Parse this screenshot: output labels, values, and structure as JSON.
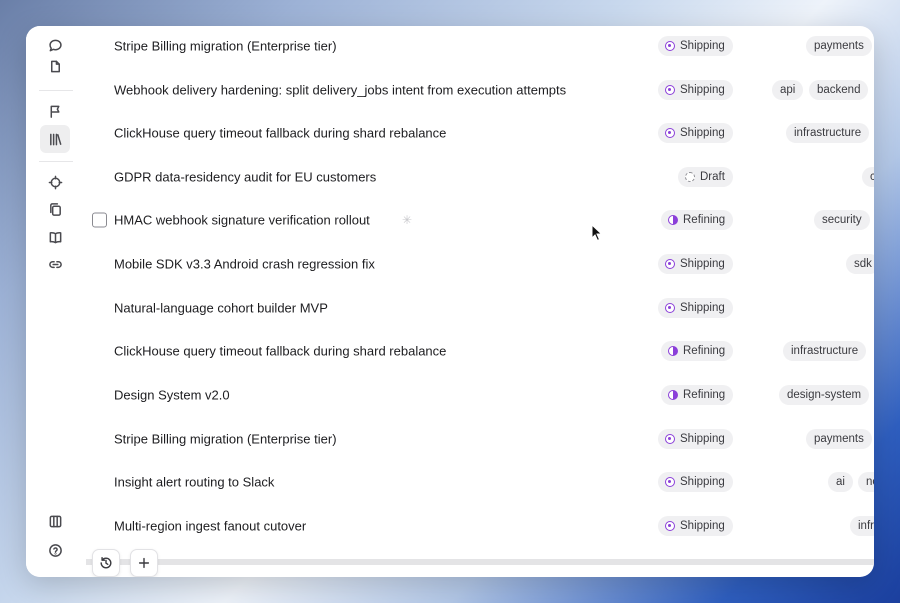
{
  "sidebar": {
    "top_icons": [
      "chat-icon",
      "document-icon"
    ],
    "mid_icons": [
      "flag-icon",
      "library-icon"
    ],
    "tool_icons": [
      "crosshair-icon",
      "copy-icon",
      "book-icon",
      "link-icon"
    ],
    "bottom_icons": [
      "columns-icon",
      "help-icon"
    ]
  },
  "rows": [
    {
      "title": "Stripe Billing migration (Enterprise tier)",
      "status": "Shipping",
      "tags": [
        "payments"
      ]
    },
    {
      "title": "Webhook delivery hardening: split delivery_jobs intent from execution attempts",
      "status": "Shipping",
      "tags": [
        "api",
        "backend"
      ]
    },
    {
      "title": "ClickHouse query timeout fallback during shard rebalance",
      "status": "Shipping",
      "tags": [
        "infrastructure"
      ]
    },
    {
      "title": "GDPR data-residency audit for EU customers",
      "status": "Draft",
      "tags": [
        "c"
      ]
    },
    {
      "title": "HMAC webhook signature verification rollout",
      "status": "Refining",
      "tags": [
        "security"
      ]
    },
    {
      "title": "Mobile SDK v3.3 Android crash regression fix",
      "status": "Shipping",
      "tags": [
        "sdk"
      ]
    },
    {
      "title": "Natural-language cohort builder MVP",
      "status": "Shipping",
      "tags": []
    },
    {
      "title": "ClickHouse query timeout fallback during shard rebalance",
      "status": "Refining",
      "tags": [
        "infrastructure"
      ]
    },
    {
      "title": "Design System v2.0",
      "status": "Refining",
      "tags": [
        "design-system"
      ]
    },
    {
      "title": "Stripe Billing migration (Enterprise tier)",
      "status": "Shipping",
      "tags": [
        "payments"
      ]
    },
    {
      "title": "Insight alert routing to Slack",
      "status": "Shipping",
      "tags": [
        "ai",
        "nc"
      ]
    },
    {
      "title": "Multi-region ingest fanout cutover",
      "status": "Shipping",
      "tags": [
        "infr"
      ]
    }
  ],
  "colors": {
    "accent": "#8b3fd9",
    "pill_bg": "#f0f0f2"
  },
  "bottom_controls": [
    "history-icon",
    "plus-icon"
  ]
}
